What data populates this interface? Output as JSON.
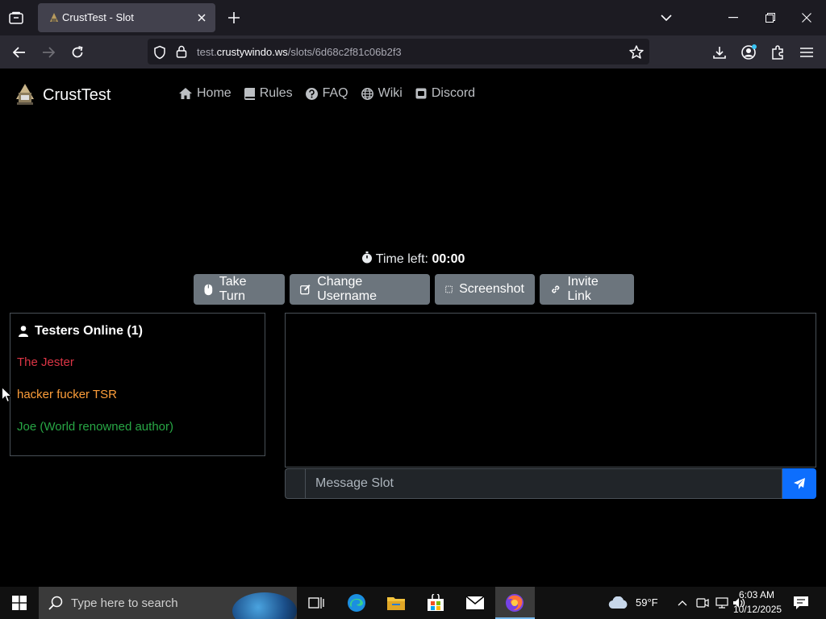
{
  "browser": {
    "tab_title": "CrustTest - Slot",
    "url_prefix": "test.",
    "url_domain": "crustywindo.ws",
    "url_path": "/slots/6d68c2f81c06b2f3"
  },
  "site": {
    "brand": "CrustTest",
    "nav": [
      "Home",
      "Rules",
      "FAQ",
      "Wiki",
      "Discord"
    ]
  },
  "timer": {
    "label": "Time left:",
    "value": "00:00"
  },
  "actions": {
    "take_turn": "Take Turn",
    "change_username": "Change Username",
    "screenshot": "Screenshot",
    "invite_link": "Invite Link"
  },
  "testers": {
    "title": "Testers Online (1)",
    "list": [
      {
        "name": "The Jester",
        "color": "#dc3545"
      },
      {
        "name": "hacker fucker TSR",
        "color": "#fd9e3a"
      },
      {
        "name": "Joe (World renowned author)",
        "color": "#28a745"
      }
    ]
  },
  "chat": {
    "placeholder": "Message Slot"
  },
  "taskbar": {
    "search_placeholder": "Type here to search",
    "weather": "59°F",
    "time": "6:03 AM",
    "date": "10/12/2025"
  }
}
